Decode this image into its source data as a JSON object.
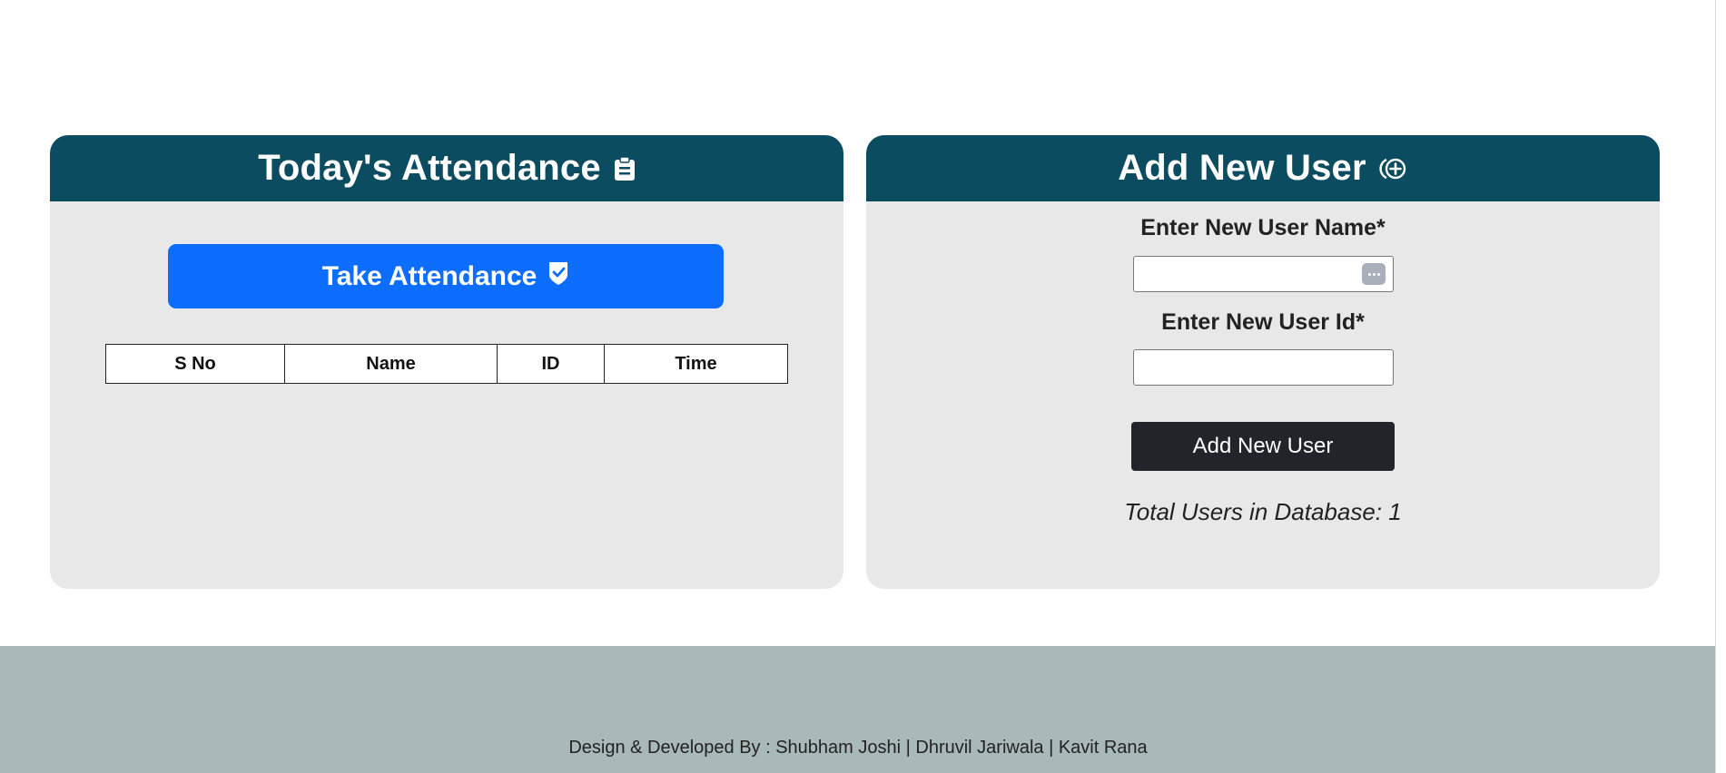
{
  "attendance_panel": {
    "title": "Today's Attendance",
    "title_icon": "clipboard-icon",
    "take_attendance_label": "Take Attendance",
    "take_attendance_icon": "shield-check-icon",
    "table": {
      "columns": [
        "S No",
        "Name",
        "ID",
        "Time"
      ],
      "rows": []
    }
  },
  "add_user_panel": {
    "title": "Add New User",
    "title_icon": "plus-circle-icon",
    "name_label": "Enter New User Name*",
    "name_value": "",
    "id_label": "Enter New User Id*",
    "id_value": "",
    "submit_label": "Add New User",
    "total_users_text": "Total Users in Database: 1"
  },
  "footer": {
    "credits": "Design & Developed By : Shubham Joshi | Dhruvil Jariwala | Kavit Rana"
  },
  "colors": {
    "header_bg": "#0c4c60",
    "panel_bg": "#e8e8e8",
    "primary_button": "#0d6efd",
    "dark_button": "#212529",
    "footer_bg": "#a9b8b9"
  }
}
